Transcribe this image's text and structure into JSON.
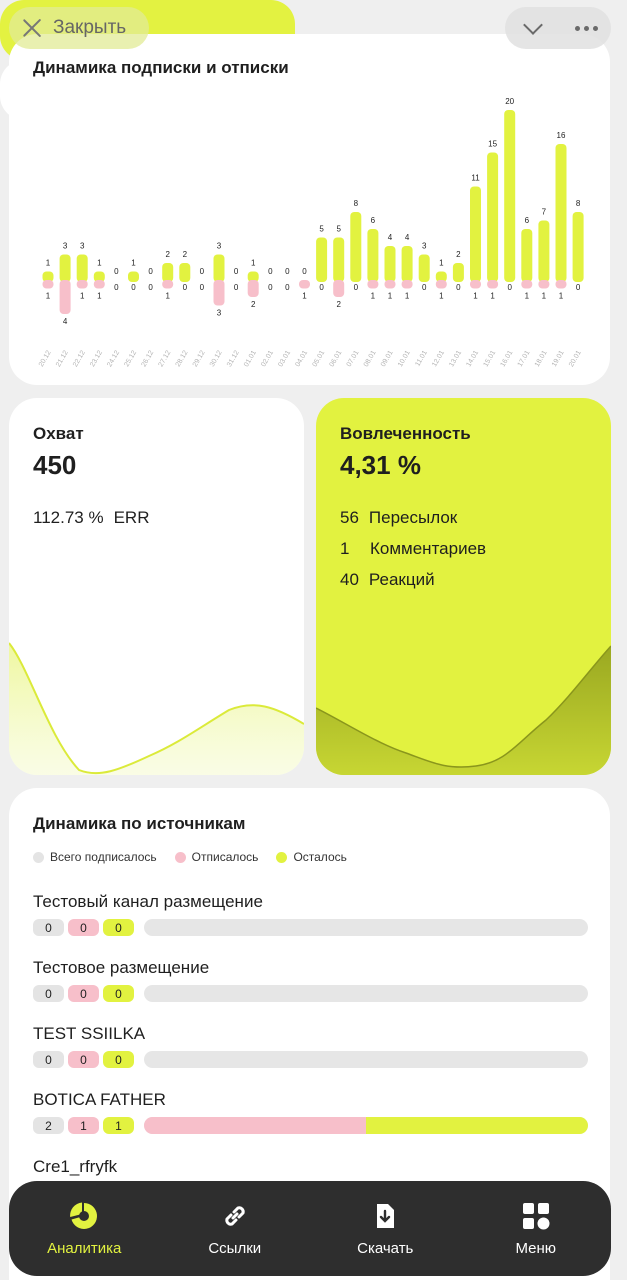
{
  "header": {
    "close_label": "Закрыть"
  },
  "colors": {
    "accent": "#E2F240",
    "pink": "#F7BFCA",
    "gray": "#E4E4E4",
    "nav_bg": "#2E2E2E"
  },
  "subs_chart": {
    "title": "Динамика подписки и отписки"
  },
  "chart_data": {
    "type": "bar",
    "categories": [
      "20.12",
      "21.12",
      "22.12",
      "23.12",
      "24.12",
      "25.12",
      "26.12",
      "27.12",
      "28.12",
      "29.12",
      "30.12",
      "31.12",
      "01.01",
      "02.01",
      "03.01",
      "04.01",
      "05.01",
      "06.01",
      "07.01",
      "08.01",
      "09.01",
      "10.01",
      "11.01",
      "12.01",
      "13.01",
      "14.01",
      "15.01",
      "16.01",
      "17.01",
      "18.01",
      "19.01",
      "20.01"
    ],
    "series": [
      {
        "values": [
          1,
          3,
          3,
          1,
          0,
          1,
          0,
          2,
          2,
          0,
          3,
          0,
          1,
          0,
          0,
          0,
          5,
          5,
          8,
          6,
          4,
          4,
          3,
          1,
          2,
          11,
          15,
          20,
          6,
          7,
          16,
          8
        ]
      },
      {
        "values": [
          1,
          4,
          1,
          1,
          0,
          0,
          0,
          1,
          0,
          0,
          3,
          0,
          2,
          0,
          0,
          1,
          0,
          2,
          0,
          1,
          1,
          1,
          0,
          1,
          0,
          1,
          1,
          0,
          1,
          1,
          1,
          0
        ]
      }
    ]
  },
  "reach": {
    "title": "Охват",
    "value": "450",
    "err_value": "112.73 %",
    "err_label": "ERR"
  },
  "engagement": {
    "title": "Вовлеченность",
    "value": "4,31 %",
    "lines": [
      {
        "num": "56",
        "label": "Пересылок"
      },
      {
        "num": "1",
        "label": "Комментариев"
      },
      {
        "num": "40",
        "label": "Реакций"
      }
    ]
  },
  "sources": {
    "title": "Динамика по источникам",
    "legend": [
      "Всего подписалось",
      "Отписалось",
      "Осталось"
    ],
    "rows": [
      {
        "name": "Тестовый канал размещение",
        "total": "0",
        "unsub": "0",
        "left": "0",
        "unsub_share": 0,
        "left_share": 0
      },
      {
        "name": "Тестовое размещение",
        "total": "0",
        "unsub": "0",
        "left": "0",
        "unsub_share": 0,
        "left_share": 0
      },
      {
        "name": "TEST SSIILKA",
        "total": "0",
        "unsub": "0",
        "left": "0",
        "unsub_share": 0,
        "left_share": 0
      },
      {
        "name": "BOTICA FATHER",
        "total": "2",
        "unsub": "1",
        "left": "1",
        "unsub_share": 0.5,
        "left_share": 0.5
      },
      {
        "name": "Cre1_rfryfk"
      }
    ]
  },
  "nav": {
    "items": [
      {
        "label": "Аналитика",
        "icon": "pie-chart-icon"
      },
      {
        "label": "Ссылки",
        "icon": "link-icon"
      },
      {
        "label": "Скачать",
        "icon": "download-icon"
      },
      {
        "label": "Меню",
        "icon": "menu-grid-icon"
      }
    ]
  }
}
